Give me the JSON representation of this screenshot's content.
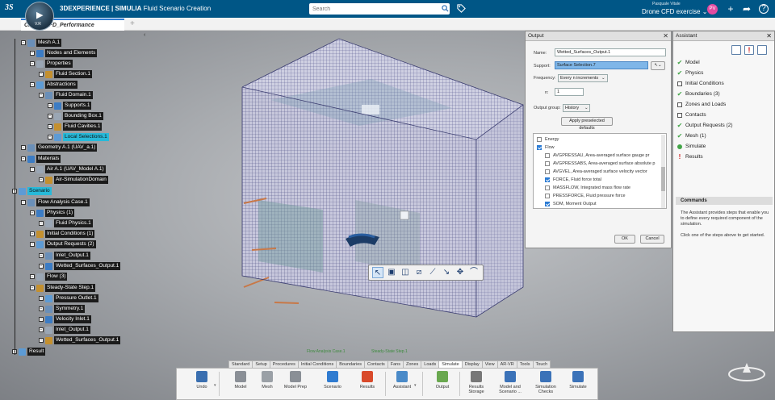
{
  "topbar": {
    "brand_bold": "3DEXPERIENCE | SIMULIA",
    "brand_app": "Fluid Scenario Creation",
    "compass_version": "V.R",
    "search_placeholder": "Search",
    "user_name": "Pasquale Vitale",
    "project": "Drone CFD exercise",
    "avatar_initials": "PV"
  },
  "tabs": {
    "active": "Cruise_CFD_Performance",
    "add": "+"
  },
  "tree": [
    {
      "label": "Mesh A.1",
      "icon": "mesh-icon",
      "indent": 1
    },
    {
      "label": "Nodes and Elements",
      "icon": "nodes-icon",
      "indent": 2
    },
    {
      "label": "Properties",
      "icon": "properties-icon",
      "indent": 2
    },
    {
      "label": "Fluid Section.1",
      "icon": "section-icon",
      "indent": 3
    },
    {
      "label": "Abstractions",
      "icon": "abstractions-icon",
      "indent": 2
    },
    {
      "label": "Fluid Domain.1",
      "icon": "domain-icon",
      "indent": 3
    },
    {
      "label": "Supports.1",
      "icon": "supports-icon",
      "indent": 4
    },
    {
      "label": "Bounding Box.1",
      "icon": "bounding-box-icon",
      "indent": 4
    },
    {
      "label": "Fluid Cavities.1",
      "icon": "cavities-icon",
      "indent": 4
    },
    {
      "label": "Local Selections.1",
      "icon": "local-selection-icon",
      "indent": 4,
      "selected": true
    },
    {
      "label": "Geometry A.1 (UAV_a.1)",
      "icon": "geometry-icon",
      "indent": 1
    },
    {
      "label": "Materials",
      "icon": "materials-icon",
      "indent": 1
    },
    {
      "label": "Air A.1 (UAV_Model A.1)",
      "icon": "air-icon",
      "indent": 2
    },
    {
      "label": "Air-SimulationDomain",
      "icon": "air-domain-icon",
      "indent": 3
    },
    {
      "label": "Scenario",
      "icon": "scenario-icon",
      "indent": 0,
      "selected": true
    },
    {
      "label": "Flow Analysis Case.1",
      "icon": "flow-case-icon",
      "indent": 1
    },
    {
      "label": "Physics (1)",
      "icon": "physics-icon",
      "indent": 2
    },
    {
      "label": "Fluid Physics.1",
      "icon": "fluid-physics-icon",
      "indent": 3
    },
    {
      "label": "Initial Conditions (1)",
      "icon": "initial-conditions-icon",
      "indent": 2
    },
    {
      "label": "Output Requests (2)",
      "icon": "output-requests-icon",
      "indent": 2
    },
    {
      "label": "Inlet_Output.1",
      "icon": "output-icon",
      "indent": 3
    },
    {
      "label": "Wetted_Surfaces_Output.1",
      "icon": "output-icon",
      "indent": 3
    },
    {
      "label": "Flow (3)",
      "icon": "flow-icon",
      "indent": 2
    },
    {
      "label": "Steady-State Step.1",
      "icon": "step-icon",
      "indent": 2
    },
    {
      "label": "Pressure Outlet.1",
      "icon": "bc-icon",
      "indent": 3
    },
    {
      "label": "Symmetry.1",
      "icon": "bc-icon",
      "indent": 3
    },
    {
      "label": "Velocity Inlet.1",
      "icon": "bc-icon",
      "indent": 3
    },
    {
      "label": "Inlet_Output.1",
      "icon": "output-icon",
      "indent": 3
    },
    {
      "label": "Wetted_Surfaces_Output.1",
      "icon": "output-icon",
      "indent": 3
    },
    {
      "label": "Result",
      "icon": "result-icon",
      "indent": 0
    }
  ],
  "output_panel": {
    "title": "Output",
    "name_label": "Name:",
    "name_value": "Wetted_Surfaces_Output.1",
    "support_label": "Support:",
    "support_value": "Surface Selection.7",
    "frequency_label": "Frequency:",
    "frequency_value": "Every n increments",
    "n_label": "n:",
    "n_value": "1",
    "group_label": "Output group:",
    "group_value": "History",
    "apply_label": "Apply preselected defaults",
    "variables": [
      {
        "label": "Energy",
        "checked": false,
        "level": 0
      },
      {
        "label": "Flow",
        "checked": true,
        "level": 0,
        "partial": true
      },
      {
        "label": "AVGPRESSAU, Area-averaged surface gauge pr",
        "checked": false,
        "level": 1
      },
      {
        "label": "AVGPRESSABS, Area-averaged surface absolute p",
        "checked": false,
        "level": 1
      },
      {
        "label": "AVGVEL, Area-averaged surface velocity vector",
        "checked": false,
        "level": 1
      },
      {
        "label": "FORCE, Fluid force total",
        "checked": true,
        "level": 1
      },
      {
        "label": "MASSFLOW, Integrated mass flow rate",
        "checked": false,
        "level": 1
      },
      {
        "label": "PRESSFORCE, Fluid pressure force",
        "checked": false,
        "level": 1
      },
      {
        "label": "SOM, Moment Output",
        "checked": true,
        "level": 1
      }
    ],
    "ok_label": "OK",
    "cancel_label": "Cancel"
  },
  "assistant": {
    "title": "Assistant",
    "steps": [
      {
        "label": "Model",
        "state": "done"
      },
      {
        "label": "Physics",
        "state": "done"
      },
      {
        "label": "Initial Conditions",
        "state": "todo"
      },
      {
        "label": "Boundaries (3)",
        "state": "done"
      },
      {
        "label": "Zones and Loads",
        "state": "todo"
      },
      {
        "label": "Contacts",
        "state": "todo"
      },
      {
        "label": "Output Requests (2)",
        "state": "done"
      },
      {
        "label": "Mesh (1)",
        "state": "done"
      },
      {
        "label": "Simulate",
        "state": "dot"
      },
      {
        "label": "Results",
        "state": "error"
      }
    ],
    "commands_header": "Commands",
    "text1": "The Assistant provides steps that enable you to define every required component of the simulation.",
    "text2": "Click one of the steps above to get started."
  },
  "viewport_tags": {
    "flow_case": "Flow Analysis Case.1",
    "step": "Steady-State Step.1"
  },
  "action_tabs": [
    "Standard",
    "Setup",
    "Procedures",
    "Initial Conditions",
    "Boundaries",
    "Contacts",
    "Fans",
    "Zones",
    "Loads",
    "Simulate",
    "Display",
    "View",
    "AR-VR",
    "Tools",
    "Touch"
  ],
  "active_action_tab": "Simulate",
  "toolbar": [
    {
      "label": "Undo",
      "icon": "undo-icon",
      "color": "#3a6fb0"
    },
    {
      "label": "Model",
      "icon": "model-icon",
      "color": "#8a8f96"
    },
    {
      "label": "Mesh",
      "icon": "mesh-tool-icon",
      "color": "#9aa0a6"
    },
    {
      "label": "Model Prep",
      "icon": "model-prep-icon",
      "color": "#8a8f96"
    },
    {
      "label": "Scenario",
      "icon": "scenario-tool-icon",
      "color": "#2f7bd0"
    },
    {
      "label": "Results",
      "icon": "results-tool-icon",
      "color": "#d94a2b"
    },
    {
      "label": "Assistant",
      "icon": "assistant-tool-icon",
      "color": "#4a8ac8"
    },
    {
      "label": "Output",
      "icon": "output-tool-icon",
      "color": "#6aa84f"
    },
    {
      "label": "Results Storage",
      "icon": "results-storage-icon",
      "color": "#777"
    },
    {
      "label": "Model and Scenario ...",
      "icon": "model-scenario-icon",
      "color": "#3b72b8"
    },
    {
      "label": "Simulation Checks",
      "icon": "simulation-checks-icon",
      "color": "#3b72b8"
    },
    {
      "label": "Simulate",
      "icon": "simulate-tool-icon",
      "color": "#3b72b8"
    }
  ]
}
